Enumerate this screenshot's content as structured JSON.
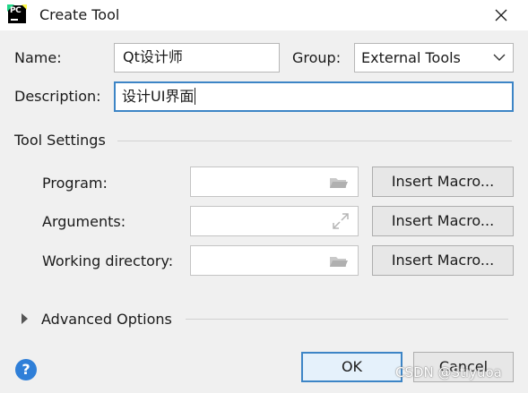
{
  "window": {
    "title": "Create Tool",
    "app_icon_label": "PC"
  },
  "form": {
    "name_label": "Name:",
    "name_value": "Qt设计师",
    "group_label": "Group:",
    "group_value": "External Tools",
    "description_label": "Description:",
    "description_value": "设计UI界面"
  },
  "tool_settings": {
    "heading": "Tool Settings",
    "program_label": "Program:",
    "program_value": "",
    "arguments_label": "Arguments:",
    "arguments_value": "",
    "working_dir_label": "Working directory:",
    "working_dir_value": "",
    "insert_macro_label": "Insert Macro..."
  },
  "advanced": {
    "label": "Advanced Options"
  },
  "footer": {
    "help_label": "?",
    "ok_label": "OK",
    "cancel_label": "Cancel"
  },
  "watermark": "CSDN @Stiyuoa",
  "colors": {
    "accent": "#3d85c6",
    "help": "#2f7fd8",
    "background": "#f0f0f0"
  }
}
